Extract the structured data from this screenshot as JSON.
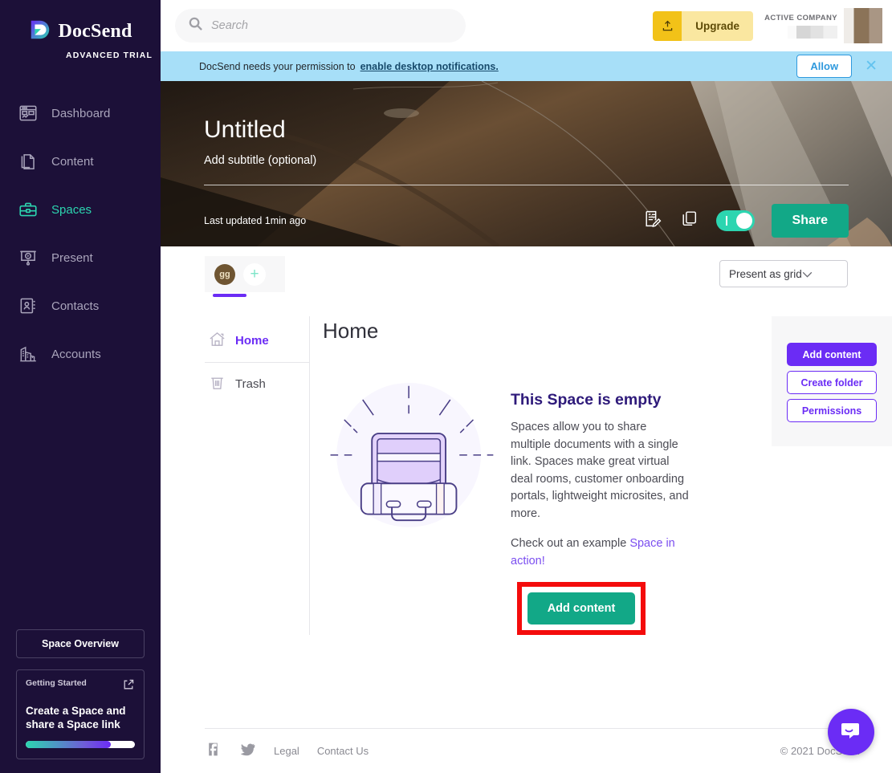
{
  "sidebar": {
    "brand": {
      "name": "DocSend",
      "plan": "ADVANCED TRIAL",
      "logo_icon": "docsend-shield-icon"
    },
    "items": [
      {
        "label": "Dashboard",
        "icon": "dashboard-icon",
        "active": false
      },
      {
        "label": "Content",
        "icon": "documents-icon",
        "active": false
      },
      {
        "label": "Spaces",
        "icon": "briefcase-icon",
        "active": true
      },
      {
        "label": "Present",
        "icon": "presentation-icon",
        "active": false
      },
      {
        "label": "Contacts",
        "icon": "contact-book-icon",
        "active": false
      },
      {
        "label": "Accounts",
        "icon": "buildings-icon",
        "active": false
      }
    ],
    "space_overview_label": "Space Overview",
    "getting_started": {
      "label": "Getting Started",
      "title": "Create a Space and share a Space link",
      "external_icon": "external-link-icon",
      "progress_percent": 78
    },
    "active_color": "#2cd5b0",
    "background_color": "#1c1038"
  },
  "topbar": {
    "search": {
      "placeholder": "Search",
      "value": "",
      "icon": "search-icon"
    },
    "upgrade": {
      "label": "Upgrade",
      "icon": "upload-icon",
      "color": "#f2c218"
    },
    "company": {
      "label": "ACTIVE COMPANY",
      "name_redacted": true,
      "avatar_icon": "avatar"
    }
  },
  "notification": {
    "text": "DocSend needs your permission to",
    "link_text": "enable desktop notifications.",
    "allow_label": "Allow",
    "close_icon": "close-icon",
    "background_color": "#a7dff8"
  },
  "hero": {
    "title": "Untitled",
    "subtitle": "Add subtitle (optional)",
    "last_updated": "Last updated 1min ago",
    "edit_icon": "edit-form-icon",
    "copy_icon": "copy-icon",
    "toggle_on": true,
    "share_label": "Share",
    "share_color": "#12a887"
  },
  "content": {
    "tab_avatar_initials": "gg",
    "add_tab_icon": "plus-icon",
    "present_as": {
      "value": "Present as grid",
      "chevron_icon": "chevron-down-icon"
    },
    "left_nav": [
      {
        "label": "Home",
        "icon": "home-icon",
        "active": true
      },
      {
        "label": "Trash",
        "icon": "trash-icon",
        "active": false
      }
    ],
    "pane_title": "Home",
    "empty_state": {
      "illustration_icon": "open-briefcase-illustration",
      "heading": "This Space is empty",
      "body": "Spaces allow you to share multiple documents with a single link. Spaces make great virtual deal rooms, customer onboarding portals, lightweight microsites, and more.",
      "body2_prefix": "Check out an example ",
      "body2_link": "Space in action!",
      "cta_label": "Add content",
      "cta_color": "#12a887",
      "highlight_border_color": "#f40c0c"
    },
    "actions": {
      "add_content_label": "Add content",
      "create_folder_label": "Create folder",
      "permissions_label": "Permissions",
      "accent_color": "#6b2cf5"
    }
  },
  "footer": {
    "facebook_icon": "facebook-icon",
    "twitter_icon": "twitter-icon",
    "links": [
      "Legal",
      "Contact Us"
    ],
    "copyright": "© 2021 DocSend"
  },
  "intercom": {
    "icon": "chat-bubble-icon",
    "color": "#6b2cf5"
  }
}
